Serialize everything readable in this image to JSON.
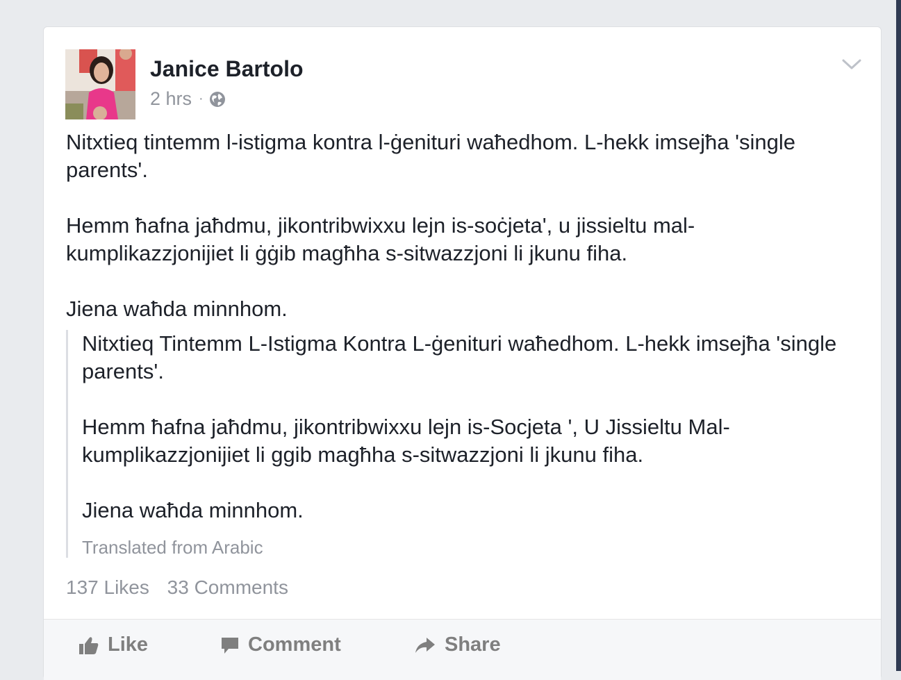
{
  "post": {
    "author": "Janice Bartolo",
    "time": "2 hrs",
    "separator": "·",
    "paragraphs": [
      "Nitxtieq tintemm l-istigma kontra l-ġenituri waħedhom. L-hekk imsejħa 'single parents'.",
      "Hemm ħafna jaħdmu, jikontribwixxu lejn is-soċjeta', u jissieltu mal-kumplikazzjonijiet li ġġib magħha s-sitwazzjoni li jkunu fiha.",
      "Jiena waħda minnhom."
    ],
    "translation": {
      "paragraphs": [
        "Nitxtieq Tintemm L-Istigma Kontra L-ġenituri waħedhom. L-hekk imsejħa 'single parents'.",
        "Hemm ħafna jaħdmu, jikontribwixxu lejn is-Socjeta ', U Jissieltu Mal-kumplikazzjonijiet li ggib magħha s-sitwazzjoni li jkunu fiha.",
        "Jiena waħda minnhom."
      ],
      "source_note": "Translated from Arabic"
    },
    "stats": {
      "likes": "137 Likes",
      "comments": "33 Comments"
    },
    "actions": {
      "like": "Like",
      "comment": "Comment",
      "share": "Share"
    }
  },
  "icons": {
    "privacy": "globe-icon",
    "menu": "chevron-down-icon",
    "like": "thumbs-up-icon",
    "comment": "speech-bubble-icon",
    "share": "share-arrow-icon"
  },
  "colors": {
    "background": "#e9ebee",
    "card": "#ffffff",
    "text": "#1d2129",
    "secondary": "#90949c",
    "action": "#7f7f7f"
  }
}
